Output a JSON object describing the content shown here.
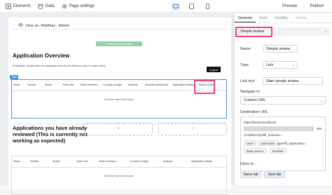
{
  "topbar": {
    "elements_label": "Elements",
    "data_label": "Data",
    "page_settings_label": "Page settings",
    "preview_label": "Preview",
    "publish_label": "Publish"
  },
  "canvas": {
    "view_as": "View as: Matthias - Admin",
    "green_bar_text": "Pretty try to fill the page",
    "overview_heading": "Application Overview",
    "hi_text": "Hi Matthias, please select an application from the list below to view it or start review",
    "logout_label": "Logout",
    "table_tag": "Table",
    "table1_headers": [
      "Name",
      "Gender",
      "Studio",
      "Team size",
      "Team members",
      "Country of origin",
      "Address",
      "Already reviewed by",
      "Application details",
      "Simple review"
    ],
    "table1_empty": "No items have been found.",
    "reviewed_heading": "Applications you have already reviewed (This is currently not working as expected)",
    "table2_headers": [
      "Name",
      "Gender",
      "Studio",
      "Team size",
      "Team members",
      "Country of origin",
      "Address",
      "Application details"
    ],
    "table2_empty": "No items have been found."
  },
  "panel": {
    "tabs": [
      "General",
      "Style",
      "Visibility",
      "Events"
    ],
    "element_name": "Simple review",
    "name_label": "Name",
    "name_value": "Simple review",
    "type_label": "Type",
    "type_value": "Link",
    "linktext_label": "Link text",
    "linktext_value": "Start simple review",
    "navigate_label": "Navigate to",
    "navigate_value": "Custom URL",
    "dest_label": "Destination URL",
    "url_line1": "https://baserow.io/form/",
    "url_line2": "304",
    "url_line3": "zV10bKU?prefill_reviewer=",
    "chip_user": "User",
    "chip_username": "Username",
    "chip_prefill": "&prefill_application=",
    "chip_datasource": "Data source",
    "chip_number": "Number",
    "open_in_label": "Open in...",
    "same_tab": "Same tab",
    "new_tab": "New tab"
  },
  "colors": {
    "highlight": "#e8467c",
    "table_selected": "#4a90e2",
    "green_bar": "#8fd3a8"
  }
}
